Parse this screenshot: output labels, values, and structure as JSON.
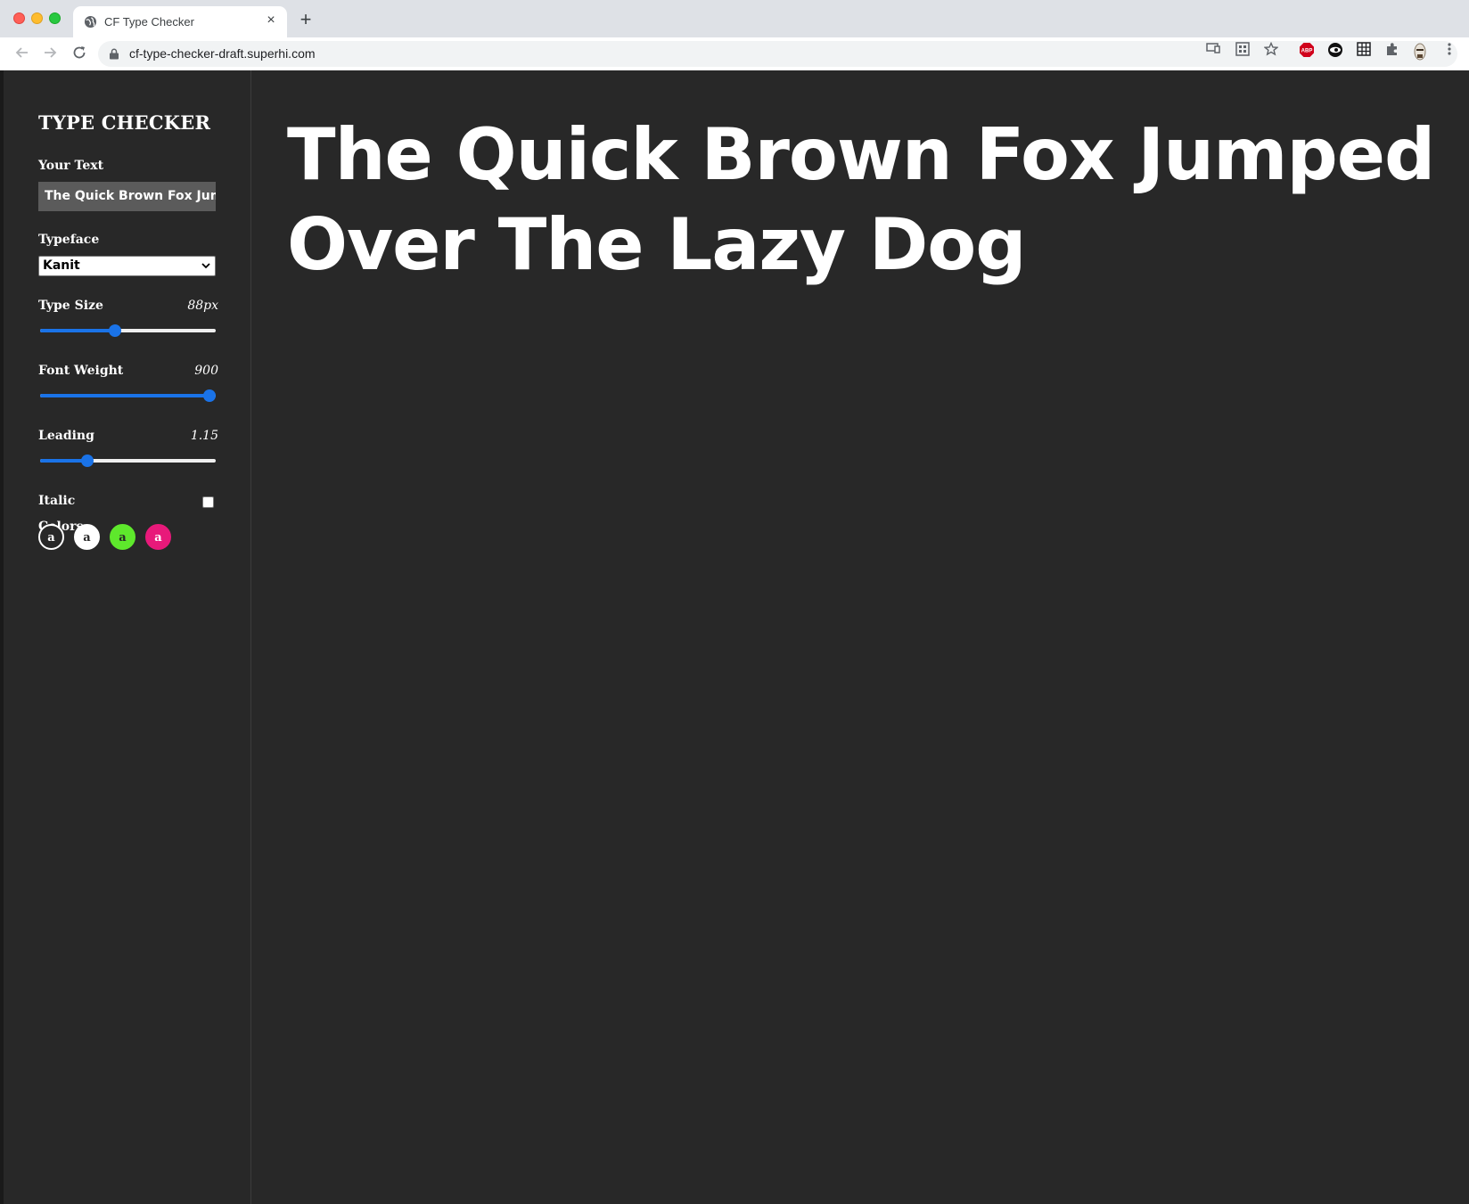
{
  "browser": {
    "tab_title": "CF Type Checker",
    "tab_close": "×",
    "new_tab": "+",
    "url": "cf-type-checker-draft.superhi.com",
    "extensions": [
      "cast-icon",
      "qr-icon",
      "bookmark-star-icon",
      "adblock-plus-icon",
      "eye-extension-icon",
      "grid-extension-icon",
      "puzzle-extensions-icon",
      "profile-avatar",
      "kebab-menu-icon"
    ]
  },
  "sidebar": {
    "title": "TYPE CHECKER",
    "your_text_label": "Your Text",
    "your_text_value": "The Quick Brown Fox Jumped Over The Lazy Dog",
    "typeface_label": "Typeface",
    "typeface_selected": "Kanit",
    "type_size_label": "Type Size",
    "type_size_value": "88px",
    "type_size_fraction": 0.42,
    "font_weight_label": "Font Weight",
    "font_weight_value": "900",
    "font_weight_fraction": 1.0,
    "leading_label": "Leading",
    "leading_value": "1.15",
    "leading_fraction": 0.25,
    "italic_label": "Italic",
    "italic_checked": false,
    "colors_label": "Colors",
    "swatches": [
      {
        "glyph": "a",
        "bg": "#282828",
        "fg": "#ffffff",
        "border": "#ffffff"
      },
      {
        "glyph": "a",
        "bg": "#ffffff",
        "fg": "#282828",
        "border": "#ffffff"
      },
      {
        "glyph": "a",
        "bg": "#5ee82c",
        "fg": "#282828",
        "border": "#5ee82c"
      },
      {
        "glyph": "a",
        "bg": "#e8197a",
        "fg": "#ffffff",
        "border": "#e8197a"
      }
    ]
  },
  "preview": {
    "text": "The Quick Brown Fox Jumped Over The Lazy Dog",
    "color": "#ffffff",
    "background": "#282828"
  },
  "colors": {
    "accent": "#1a73e8"
  }
}
